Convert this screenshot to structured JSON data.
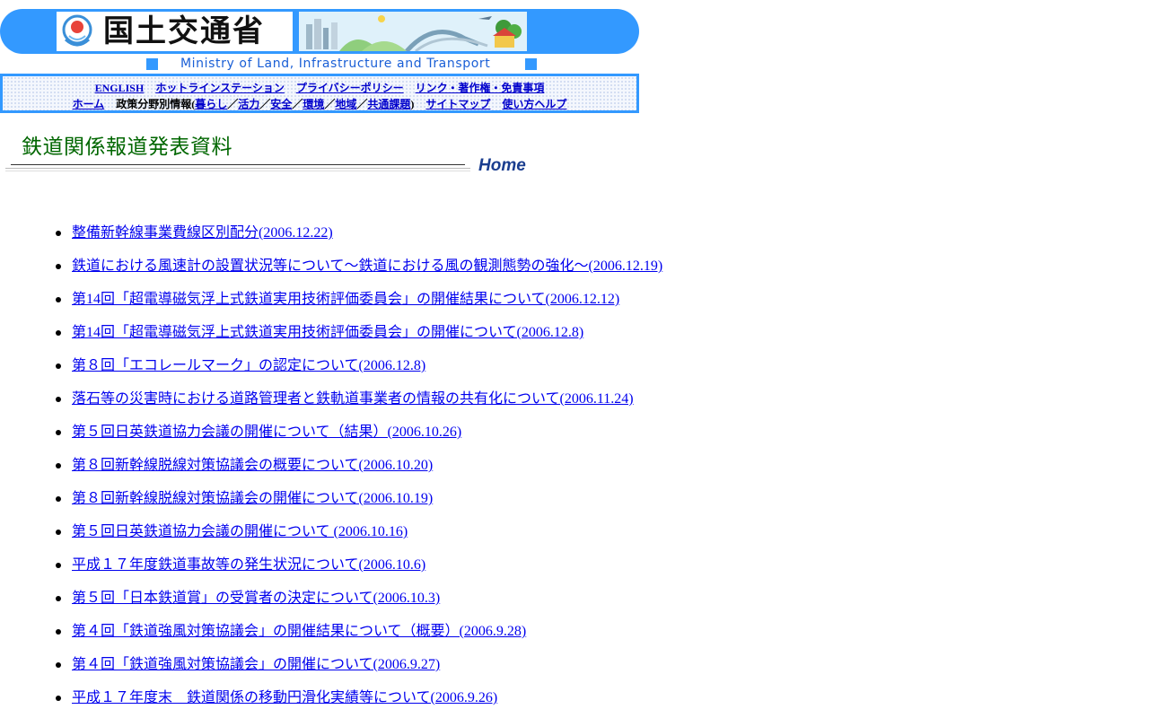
{
  "header": {
    "logo_text": "国土交通省",
    "ministry_en": "Ministry of Land, Infrastructure and Transport"
  },
  "nav": {
    "row1": [
      "ENGLISH",
      "ホットラインステーション",
      "プライバシーポリシー",
      "リンク・著作権・免責事項"
    ],
    "home": "ホーム",
    "policy_prefix": "政策分野別情報(",
    "policy_items": [
      "暮らし",
      "活力",
      "安全",
      "環境",
      "地域",
      "共通課題"
    ],
    "separator": "／",
    "policy_suffix": ")",
    "sitemap": "サイトマップ",
    "help": "使い方ヘルプ"
  },
  "page": {
    "title": "鉄道関係報道発表資料",
    "home_link": "Home"
  },
  "news": [
    "整備新幹線事業費線区別配分(2006.12.22)",
    "鉄道における風速計の設置状況等について～鉄道における風の観測態勢の強化～(2006.12.19)",
    "第14回「超電導磁気浮上式鉄道実用技術評価委員会」の開催結果について(2006.12.12)",
    "第14回「超電導磁気浮上式鉄道実用技術評価委員会」の開催について(2006.12.8)",
    "第８回「エコレールマーク」の認定について(2006.12.8)",
    "落石等の災害時における道路管理者と鉄軌道事業者の情報の共有化について(2006.11.24)",
    "第５回日英鉄道協力会議の開催について（結果）(2006.10.26)",
    "第８回新幹線脱線対策協議会の概要について(2006.10.20)",
    "第８回新幹線脱線対策協議会の開催について(2006.10.19)",
    "第５回日英鉄道協力会議の開催について (2006.10.16)",
    "平成１７年度鉄道事故等の発生状況について(2006.10.6)",
    "第５回「日本鉄道賞」の受賞者の決定について(2006.10.3)",
    "第４回「鉄道強風対策協議会」の開催結果について（概要）(2006.9.28)",
    "第４回「鉄道強風対策協議会」の開催について(2006.9.27)",
    "平成１７年度末　鉄道関係の移動円滑化実績等について(2006.9.26)"
  ]
}
